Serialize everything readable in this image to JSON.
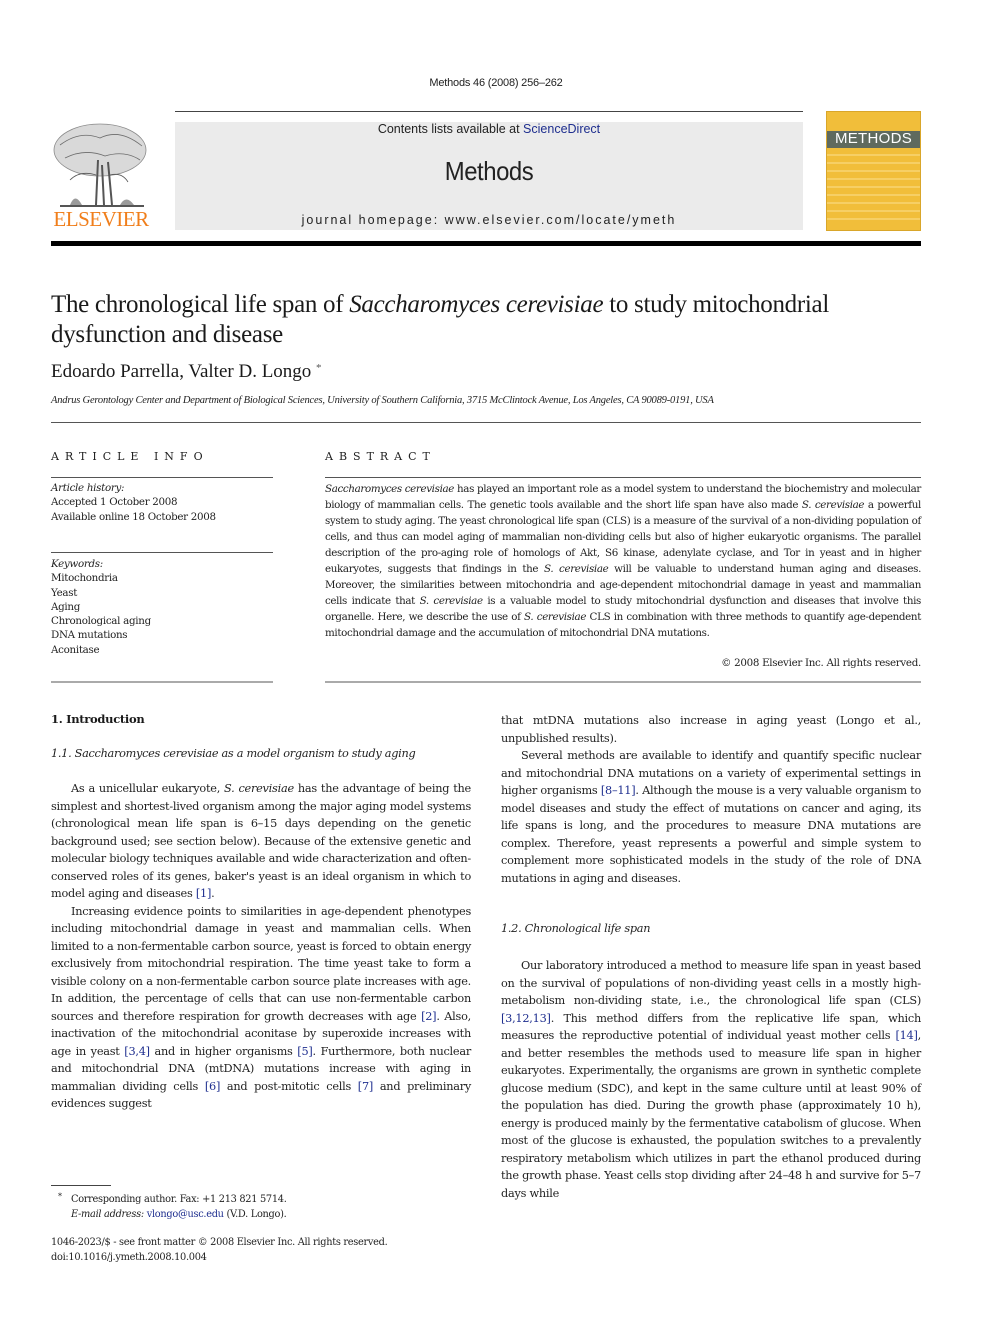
{
  "header": {
    "journal_reference": "Methods 46 (2008) 256–262",
    "contents_prefix": "Contents lists available at ",
    "contents_link": "ScienceDirect",
    "journal_title": "Methods",
    "homepage_line": "journal homepage: www.elsevier.com/locate/ymeth",
    "publisher_logo_text": "ELSEVIER",
    "cover_title": "METHODS",
    "colors": {
      "publisher_orange": "#f07e1b",
      "cover_yellow": "#f1be3a",
      "link_blue": "#1f2f8f"
    }
  },
  "article": {
    "title_part1": "The chronological life span of ",
    "title_italic": "Saccharomyces cerevisiae",
    "title_part2": " to study mitochondrial dysfunction and disease",
    "authors": "Edoardo Parrella, Valter D. Longo",
    "author_mark": "*",
    "affiliation": "Andrus Gerontology Center and Department of Biological Sciences, University of Southern California, 3715 McClintock Avenue, Los Angeles, CA 90089-0191, USA"
  },
  "article_info": {
    "heading": "ARTICLE INFO",
    "history_label": "Article history:",
    "history": [
      "Accepted 1 October 2008",
      "Available online 18 October 2008"
    ],
    "keywords_label": "Keywords:",
    "keywords": [
      "Mitochondria",
      "Yeast",
      "Aging",
      "Chronological aging",
      "DNA mutations",
      "Aconitase"
    ]
  },
  "abstract": {
    "heading": "ABSTRACT",
    "s1_it": "Saccharomyces cerevisiae",
    "s1": " has played an important role as a model system to understand the biochemistry and molecular biology of mammalian cells. The genetic tools available and the short life span have also made ",
    "s2_it": "S. cerevisiae",
    "s2": " a powerful system to study aging. The yeast chronological life span (CLS) is a measure of the survival of a non-dividing population of cells, and thus can model aging of mammalian non-dividing cells but also of higher eukaryotic organisms. The parallel description of the pro-aging role of homologs of Akt, S6 kinase, adenylate cyclase, and Tor in yeast and in higher eukaryotes, suggests that findings in the ",
    "s3_it": "S. cerevisiae",
    "s3": " will be valuable to understand human aging and diseases. Moreover, the similarities between mitochondria and age-dependent mitochondrial damage in yeast and mammalian cells indicate that ",
    "s4_it": "S. cerevisiae",
    "s4": " is a valuable model to study mitochondrial dysfunction and diseases that involve this organelle. Here, we describe the use of ",
    "s5_it": "S. cerevisiae",
    "s5": " CLS in combination with three methods to quantify age-dependent mitochondrial damage and the accumulation of mitochondrial DNA mutations.",
    "copyright": "© 2008 Elsevier Inc. All rights reserved."
  },
  "body": {
    "section1_heading": "1. Introduction",
    "section11_heading": "1.1. Saccharomyces cerevisiae as a model organism to study aging",
    "p1_a": "As a unicellular eukaryote, ",
    "p1_it": "S. cerevisiae",
    "p1_b": " has the advantage of being the simplest and shortest-lived organism among the major aging model systems (chronological mean life span is 6–15 days depending on the genetic background used; see section below). Because of the extensive genetic and molecular biology techniques available and wide characterization and often-conserved roles of its genes, baker's yeast is an ideal organism in which to model aging and diseases ",
    "p1_ref1": "[1]",
    "p1_end": ".",
    "p2_a": "Increasing evidence points to similarities in age-dependent phenotypes including mitochondrial damage in yeast and mammalian cells. When limited to a non-fermentable carbon source, yeast is forced to obtain energy exclusively from mitochondrial respiration. The time yeast take to form a visible colony on a non-fermentable carbon source plate increases with age. In addition, the percentage of cells that can use non-fermentable carbon sources and therefore respiration for growth decreases with age ",
    "p2_ref2": "[2]",
    "p2_b": ". Also, inactivation of the mitochondrial aconitase by superoxide increases with age in yeast ",
    "p2_ref34": "[3,4]",
    "p2_c": " and in higher organisms ",
    "p2_ref5": "[5]",
    "p2_d": ". Furthermore, both nuclear and mitochondrial DNA (mtDNA) mutations increase with aging in mammalian dividing cells ",
    "p2_ref6": "[6]",
    "p2_e": " and post-mitotic cells ",
    "p2_ref7": "[7]",
    "p2_f": " and preliminary evidences suggest that mtDNA mutations also increase in aging yeast (Longo et al., unpublished results).",
    "p3_a": "Several methods are available to identify and quantify specific nuclear and mitochondrial DNA mutations on a variety of experimental settings in higher organisms ",
    "p3_ref": "[8–11]",
    "p3_b": ". Although the mouse is a very valuable organism to model diseases and study the effect of mutations on cancer and aging, its life spans is long, and the procedures to measure DNA mutations are complex. Therefore, yeast represents a powerful and simple system to complement more sophisticated models in the study of the role of DNA mutations in aging and diseases.",
    "section12_heading": "1.2. Chronological life span",
    "p4_a": "Our laboratory introduced a method to measure life span in yeast based on the survival of populations of non-dividing yeast cells in a mostly high-metabolism non-dividing state, i.e., the chronological life span (CLS) ",
    "p4_ref1": "[3,12,13]",
    "p4_b": ". This method differs from the replicative life span, which measures the reproductive potential of individual yeast mother cells ",
    "p4_ref2": "[14]",
    "p4_c": ", and better resembles the methods used to measure life span in higher eukaryotes. Experimentally, the organisms are grown in synthetic complete glucose medium (SDC), and kept in the same culture until at least 90% of the population has died. During the growth phase (approximately 10 h), energy is produced mainly by the fermentative catabolism of glucose. When most of the glucose is exhausted, the population switches to a prevalently respiratory metabolism which utilizes in part the ethanol produced during the growth phase. Yeast cells stop dividing after 24–48 h and survive for 5–7 days while"
  },
  "footnote": {
    "star": "*",
    "corresponding": "Corresponding author. Fax: +1 213 821 5714.",
    "email_label": "E-mail address:",
    "email": "vlongo@usc.edu",
    "email_suffix": " (V.D. Longo).",
    "front_matter": "1046-2023/$ - see front matter © 2008 Elsevier Inc. All rights reserved.",
    "doi": "doi:10.1016/j.ymeth.2008.10.004"
  }
}
